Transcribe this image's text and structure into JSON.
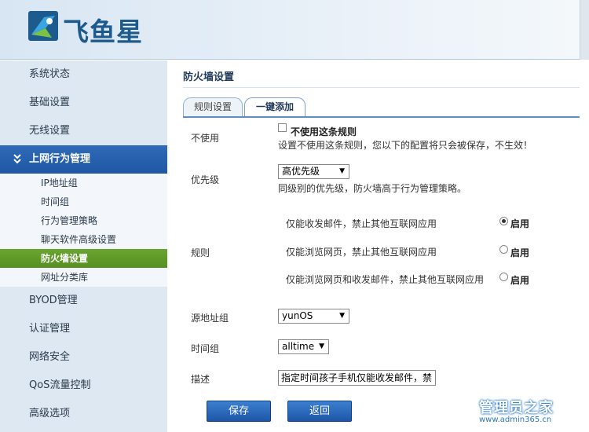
{
  "brand": {
    "logo_text": "飞鱼星"
  },
  "sidebar": {
    "items": [
      {
        "label": "系统状态"
      },
      {
        "label": "基础设置"
      },
      {
        "label": "无线设置"
      },
      {
        "label": "上网行为管理",
        "chevron": "»"
      },
      {
        "label": "BYOD管理"
      },
      {
        "label": "认证管理"
      },
      {
        "label": "网络安全"
      },
      {
        "label": "QoS流量控制"
      },
      {
        "label": "高级选项"
      }
    ],
    "sub_items": [
      {
        "label": "IP地址组"
      },
      {
        "label": "时间组"
      },
      {
        "label": "行为管理策略"
      },
      {
        "label": "聊天软件高级设置"
      },
      {
        "label": "防火墙设置"
      },
      {
        "label": "网址分类库"
      }
    ]
  },
  "main": {
    "title": "防火墙设置",
    "tabs": [
      {
        "label": "规则设置"
      },
      {
        "label": "一键添加"
      }
    ],
    "disable": {
      "label": "不使用",
      "checkbox_label": "不使用这条规则",
      "hint": "设置不使用这条规则，您以下的配置将只会被保存，不生效！"
    },
    "priority": {
      "label": "优先级",
      "value": "高优先级",
      "hint": "同级别的优先级，防火墙高于行为管理策略。"
    },
    "rules": {
      "label": "规则",
      "options": [
        {
          "text": "仅能收发邮件，禁止其他互联网应用",
          "radio_label": "启用",
          "selected": true
        },
        {
          "text": "仅能浏览网页，禁止其他互联网应用",
          "radio_label": "启用",
          "selected": false
        },
        {
          "text": "仅能浏览网页和收发邮件，禁止其他互联网应用",
          "radio_label": "启用",
          "selected": false
        }
      ]
    },
    "source_group": {
      "label": "源地址组",
      "value": "yunOS"
    },
    "time_group": {
      "label": "时间组",
      "value": "alltime"
    },
    "description": {
      "label": "描述",
      "value": "指定时间孩子手机仅能收发邮件，禁"
    },
    "buttons": {
      "save": "保存",
      "back": "返回"
    }
  },
  "watermark": {
    "title": "管理员之家",
    "url": "www.admin365.cn"
  },
  "select_arrow": "▼"
}
